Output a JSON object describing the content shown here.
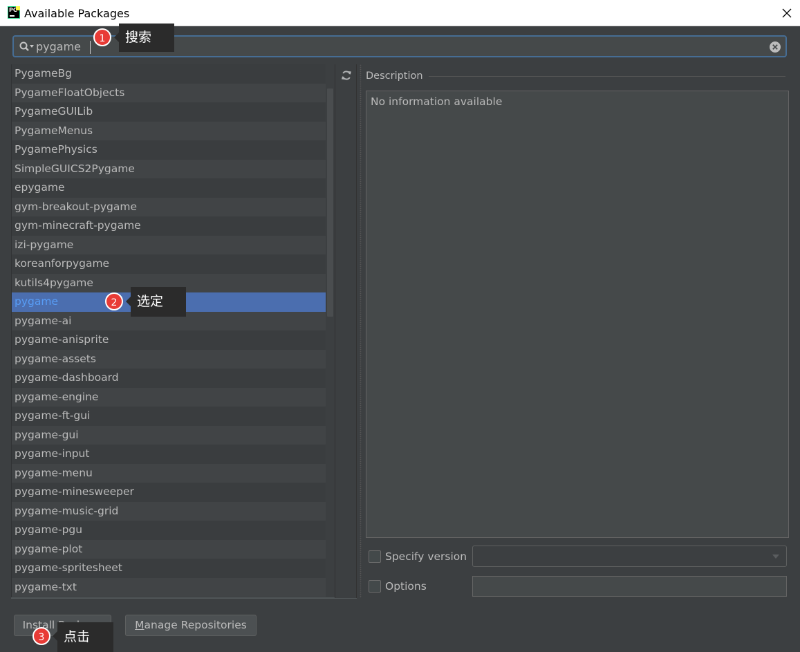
{
  "window": {
    "title": "Available Packages"
  },
  "search": {
    "value": "pygame",
    "placeholder": ""
  },
  "packages": [
    "PygameBg",
    "PygameFloatObjects",
    "PygameGUILib",
    "PygameMenus",
    "PygamePhysics",
    "SimpleGUICS2Pygame",
    "epygame",
    "gym-breakout-pygame",
    "gym-minecraft-pygame",
    "izi-pygame",
    "koreanforpygame",
    "kutils4pygame",
    "pygame",
    "pygame-ai",
    "pygame-anisprite",
    "pygame-assets",
    "pygame-dashboard",
    "pygame-engine",
    "pygame-ft-gui",
    "pygame-gui",
    "pygame-input",
    "pygame-menu",
    "pygame-minesweeper",
    "pygame-music-grid",
    "pygame-pgu",
    "pygame-plot",
    "pygame-spritesheet",
    "pygame-txt"
  ],
  "selected_package": "pygame",
  "description": {
    "label": "Description",
    "text": "No information available"
  },
  "options": {
    "specify_version_label": "Specify version",
    "specify_version_checked": false,
    "version_value": "",
    "options_label": "Options",
    "options_checked": false,
    "options_value": ""
  },
  "buttons": {
    "install_label": "Install Package",
    "manage_label_u": "M",
    "manage_label_rest": "anage Repositories"
  },
  "annotations": [
    {
      "number": "1",
      "text": "搜索"
    },
    {
      "number": "2",
      "text": "选定"
    },
    {
      "number": "3",
      "text": "点击"
    }
  ],
  "colors": {
    "background": "#3c3f41",
    "selection": "#4b6eaf",
    "selected_text": "#589df6",
    "badge": "#e83b36",
    "callout": "#2b2b2b"
  }
}
